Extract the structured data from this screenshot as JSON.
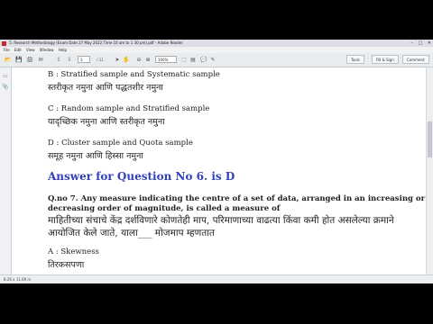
{
  "window": {
    "title": "5. Research Methodology (Exam Date 27 May 2022 Time 10 am to 1 30 pm).pdf - Adobe Reader",
    "controls": [
      "–",
      "□",
      "✕"
    ]
  },
  "menu": [
    "File",
    "Edit",
    "View",
    "Window",
    "Help"
  ],
  "toolbar": {
    "page_current": "3",
    "page_total": "/ 11",
    "zoom": "106%",
    "tools_label": "Tools",
    "fill_sign_label": "Fill & Sign",
    "comment_label": "Comment"
  },
  "status": {
    "page_size": "8.26 x 11.69 in"
  },
  "content": {
    "option_b_en": "B : Stratified sample and Systematic sample",
    "option_b_mr": "स्तरीकृत नमुना आणि पद्धतशीर नमुना",
    "option_c_en": "C : Random sample and Stratified sample",
    "option_c_mr": "यादृच्छिक नमुना आणि स्तरीकृत नमुना",
    "option_d_en": "D : Cluster sample and Quota sample",
    "option_d_mr": "समूह नमुना आणि हिस्सा नमुना",
    "answer": "Answer for Question No 6. is D",
    "q7_line1": "Q.no 7. Any measure indicating the centre of a set of data, arranged in an increasing or",
    "q7_line2": "decreasing order of magnitude, is called a measure of",
    "q7_mr_line1": "माहितीच्या संचाचे केंद्र दर्शविणारे कोणतेही माप, परिमाणाच्या वाढत्या किंवा कमी होत असलेल्या क्रमाने",
    "q7_mr_line2": "आयोजित केले जाते, याला___ मोजमाप म्हणतात",
    "q7_option_a_en": "A : Skewness",
    "q7_option_a_mr": "तिरकसपणा"
  }
}
